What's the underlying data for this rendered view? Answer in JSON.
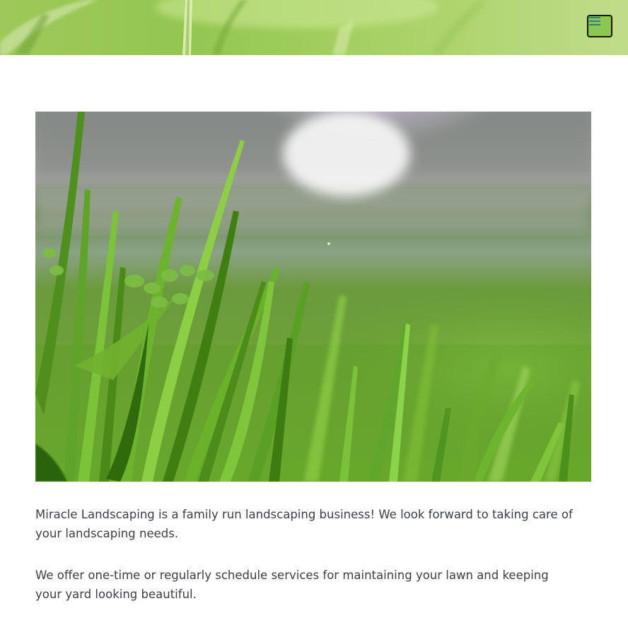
{
  "header": {
    "menu_icon": "hamburger-menu-icon",
    "menu_button_color": "#2a7f8f"
  },
  "hero": {
    "image": "close-up grass photo with sun flare"
  },
  "content": {
    "paragraphs": [
      "Miracle Landscaping is a family run landscaping business! We look forward to taking care of your landscaping needs.",
      "We offer one-time or regularly schedule services for maintaining your lawn and keeping your yard looking beautiful."
    ]
  }
}
